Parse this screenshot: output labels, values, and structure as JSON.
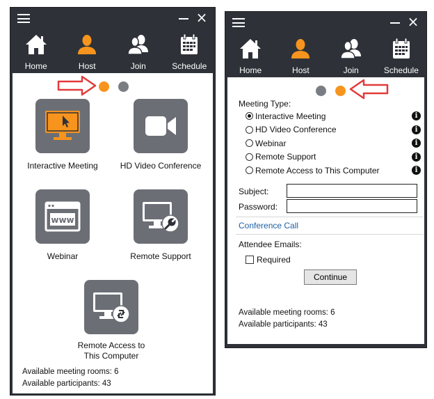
{
  "nav": {
    "items": [
      {
        "label": "Home",
        "icon": "home-icon"
      },
      {
        "label": "Host",
        "icon": "host-user-icon",
        "active": true
      },
      {
        "label": "Join",
        "icon": "join-users-icon"
      },
      {
        "label": "Schedule",
        "icon": "calendar-icon"
      }
    ]
  },
  "colors": {
    "accent": "#f7941d",
    "titlebar": "#2e3238",
    "tile": "#6b6e75",
    "arrow": "#e23b3b",
    "link": "#1f5fa5"
  },
  "left": {
    "tiles": [
      {
        "label": "Interactive Meeting",
        "icon": "monitor-cursor-icon"
      },
      {
        "label": "HD Video Conference",
        "icon": "video-camera-icon"
      },
      {
        "label": "Webinar",
        "icon": "browser-www-icon"
      },
      {
        "label": "Remote Support",
        "icon": "monitor-wrench-icon"
      },
      {
        "label": "Remote Access to This Computer",
        "label_line1": "Remote Access to",
        "label_line2": "This Computer",
        "icon": "monitor-remote-icon"
      }
    ],
    "rooms": "Available meeting rooms: 6",
    "participants": "Available participants: 43"
  },
  "right": {
    "meeting_type_label": "Meeting Type:",
    "options": [
      {
        "label": "Interactive Meeting",
        "checked": true
      },
      {
        "label": "HD Video Conference",
        "checked": false
      },
      {
        "label": "Webinar",
        "checked": false
      },
      {
        "label": "Remote Support",
        "checked": false
      },
      {
        "label": "Remote Access to This Computer",
        "checked": false
      }
    ],
    "subject_label": "Subject:",
    "subject_value": "",
    "password_label": "Password:",
    "password_value": "",
    "conference_call": "Conference Call",
    "attendee_emails_label": "Attendee Emails:",
    "required_label": "Required",
    "continue_label": "Continue",
    "rooms": "Available meeting rooms: 6",
    "participants": "Available participants: 43"
  },
  "pager": {
    "left_active": 1,
    "right_active": 2
  }
}
